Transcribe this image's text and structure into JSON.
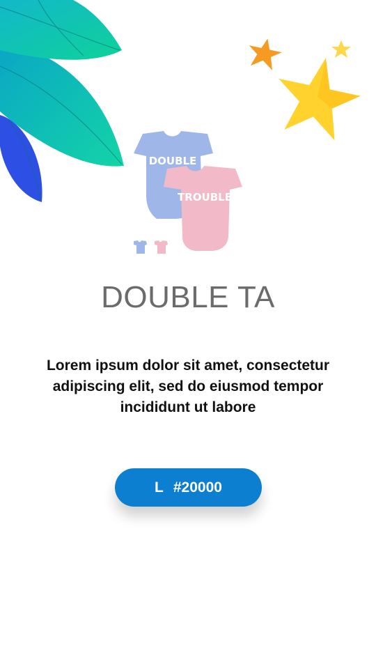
{
  "product": {
    "title": "DOUBLE TA",
    "image_labels": [
      "DOUBLE",
      "TROUBLE"
    ],
    "description": "Lorem ipsum dolor sit amet, consectetur adipiscing elit, sed do eiusmod tempor incididunt ut labore",
    "size": "L",
    "price": "#20000"
  },
  "colors": {
    "accent": "#0d7fd1",
    "onesie_blue": "#9fb7e8",
    "onesie_pink": "#f2b9c8",
    "star_yellow": "#ffd22e",
    "star_orange": "#f59b23",
    "leaf_teal": "#10c4b7",
    "leaf_blue": "#2f5be0"
  },
  "icons": [
    "leaf-decoration",
    "star-decoration"
  ]
}
